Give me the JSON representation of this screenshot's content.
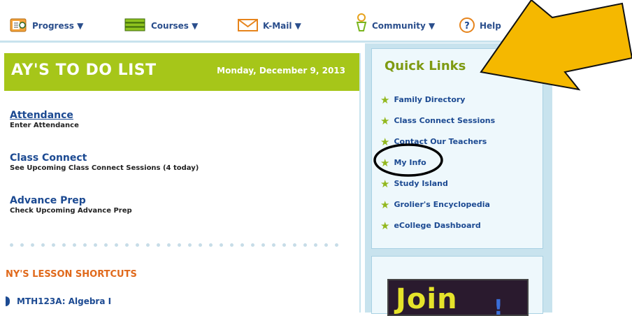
{
  "nav": {
    "progress": "Progress ▼",
    "courses": "Courses ▼",
    "kmail": "K-Mail ▼",
    "community": "Community ▼",
    "help": "Help"
  },
  "todo": {
    "title": "AY'S TO DO LIST",
    "date": "Monday, December 9, 2013",
    "tasks": [
      {
        "title": "Attendance",
        "subtitle": "Enter Attendance"
      },
      {
        "title": "Class Connect",
        "subtitle": "See Upcoming Class Connect Sessions (4 today)"
      },
      {
        "title": "Advance Prep",
        "subtitle": "Check Upcoming Advance Prep"
      }
    ]
  },
  "shortcuts": {
    "title": "NY'S LESSON SHORTCUTS",
    "course": "MTH123A: Algebra I"
  },
  "quick_links": {
    "title": "Quick Links",
    "items": [
      "Family Directory",
      "Class Connect Sessions",
      "Contact Our Teachers",
      "My Info",
      "Study Island",
      "Grolier's Encyclopedia",
      "eCollege Dashboard"
    ]
  },
  "promo": {
    "text": "Join"
  },
  "colors": {
    "header_green": "#a6c619",
    "link_blue": "#1c4a92",
    "orange_heading": "#e0691b",
    "arrow_yellow": "#f5b800",
    "panel_blue": "#c8e3ee"
  }
}
